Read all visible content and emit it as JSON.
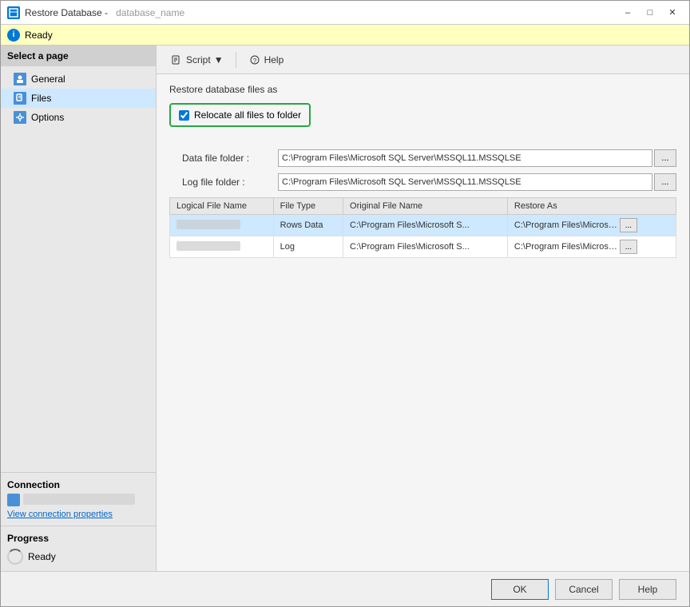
{
  "window": {
    "title": "Restore Database -",
    "title_suffix": "database_name"
  },
  "status_bar": {
    "message": "Ready",
    "icon": "i"
  },
  "sidebar": {
    "section_title": "Select a page",
    "items": [
      {
        "id": "general",
        "label": "General"
      },
      {
        "id": "files",
        "label": "Files"
      },
      {
        "id": "options",
        "label": "Options"
      }
    ],
    "connection_title": "Connection",
    "connection_link": "View connection properties",
    "progress_title": "Progress",
    "progress_status": "Ready"
  },
  "toolbar": {
    "script_label": "Script",
    "help_label": "Help"
  },
  "content": {
    "restore_files_as": "Restore database files as",
    "relocate_label": "Relocate all files to folder",
    "data_file_folder_label": "Data file folder :",
    "data_file_folder_value": "C:\\Program Files\\Microsoft SQL Server\\MSSQL11.MSSQLSE",
    "log_file_folder_label": "Log file folder :",
    "log_file_folder_value": "C:\\Program Files\\Microsoft SQL Server\\MSSQL11.MSSQLSE",
    "table": {
      "columns": [
        "Logical File Name",
        "File Type",
        "Original File Name",
        "Restore As"
      ],
      "rows": [
        {
          "logical_name": "████████",
          "file_type": "Rows Data",
          "original_file": "C:\\Program Files\\Microsoft S...",
          "restore_as": "C:\\Program Files\\Microsoft S...",
          "selected": true
        },
        {
          "logical_name": "████████",
          "file_type": "Log",
          "original_file": "C:\\Program Files\\Microsoft S...",
          "restore_as": "C:\\Program Files\\Microsoft S...",
          "selected": false
        }
      ]
    }
  },
  "footer": {
    "ok_label": "OK",
    "cancel_label": "Cancel",
    "help_label": "Help"
  }
}
